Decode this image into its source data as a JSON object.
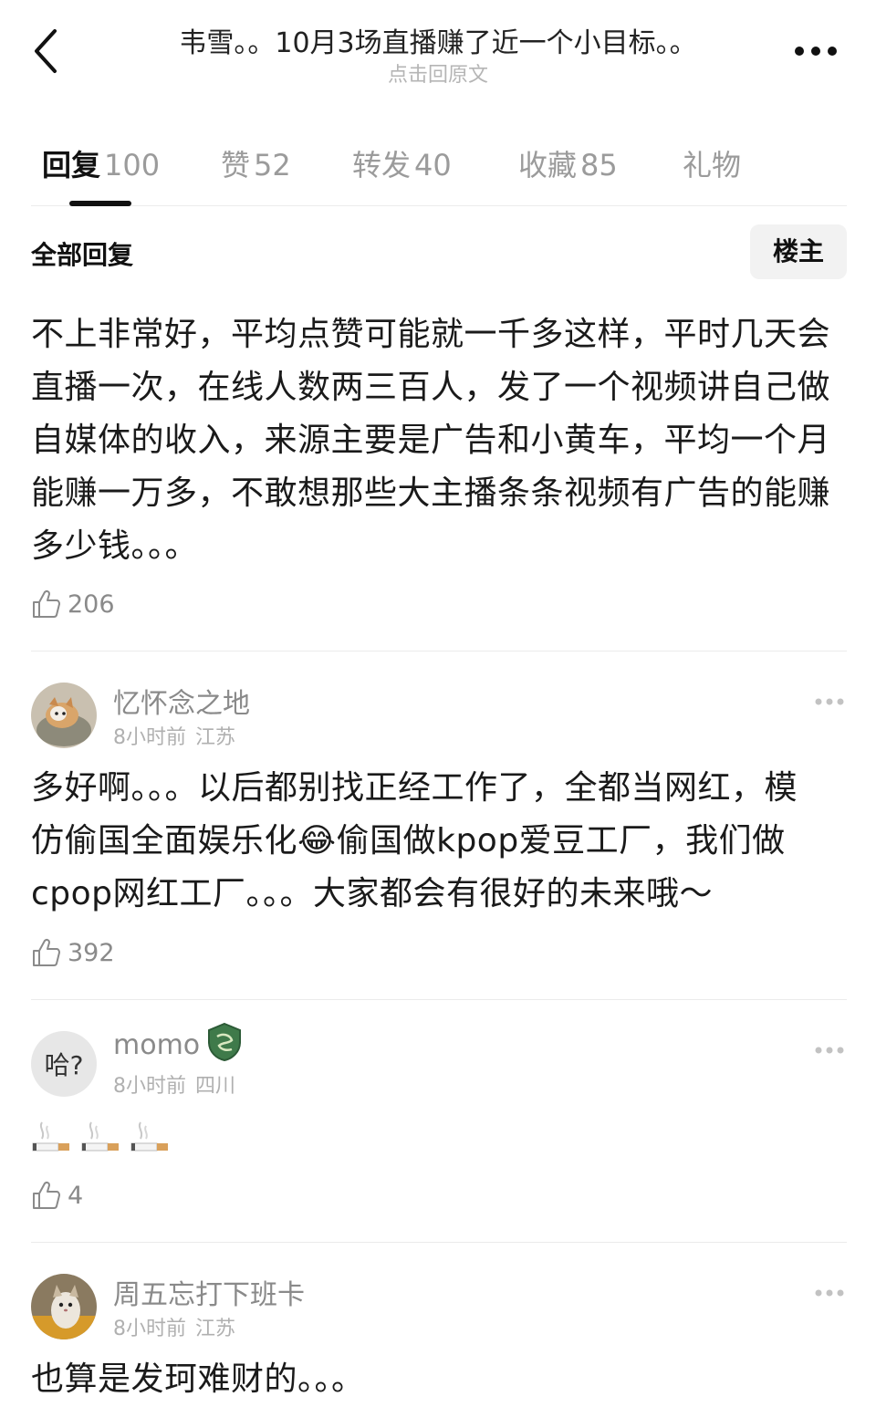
{
  "header": {
    "title": "韦雪。。10月3场直播赚了近一个小目标。。",
    "subtitle": "点击回原文"
  },
  "tabs": [
    {
      "label": "回复",
      "count": "100"
    },
    {
      "label": "赞",
      "count": "52"
    },
    {
      "label": "转发",
      "count": "40"
    },
    {
      "label": "收藏",
      "count": "85"
    },
    {
      "label": "礼物",
      "count": ""
    }
  ],
  "filter": {
    "all_label": "全部回复",
    "owner_label": "楼主"
  },
  "first_comment": {
    "lines": [
      "不上非常好，平均点赞可能就一千多这样，平时几天会",
      "直播一次，在线人数两三百人，发了一个视频讲自己做",
      "自媒体的收入，来源主要是广告和小黄车，平均一个月",
      "能赚一万多，不敢想那些大主播条条视频有广告的能赚",
      "多少钱。。。"
    ],
    "likes": "206"
  },
  "comments": [
    {
      "user": "忆怀念之地",
      "time": "8小时前",
      "location": "江苏",
      "text_line1": "多好啊。。。以后都别找正经工作了，全都当网红，模",
      "text_line2a": "仿偷国全面娱乐化",
      "emoji": "😂",
      "text_line2b": "偷国做kpop爱豆工厂，我们做",
      "text_line3": "cpop网红工厂。。。大家都会有很好的未来哦～",
      "likes": "392"
    },
    {
      "user": "momo",
      "time": "8小时前",
      "location": "四川",
      "likes": "4",
      "avatar_text": "哈?"
    },
    {
      "user": "周五忘打下班卡",
      "time": "8小时前",
      "location": "江苏",
      "text": "也算是发珂难财的。。。"
    }
  ],
  "colors": {
    "text": "#1a1a1a",
    "muted": "#8a8a8a",
    "divider": "#ebebeb"
  }
}
